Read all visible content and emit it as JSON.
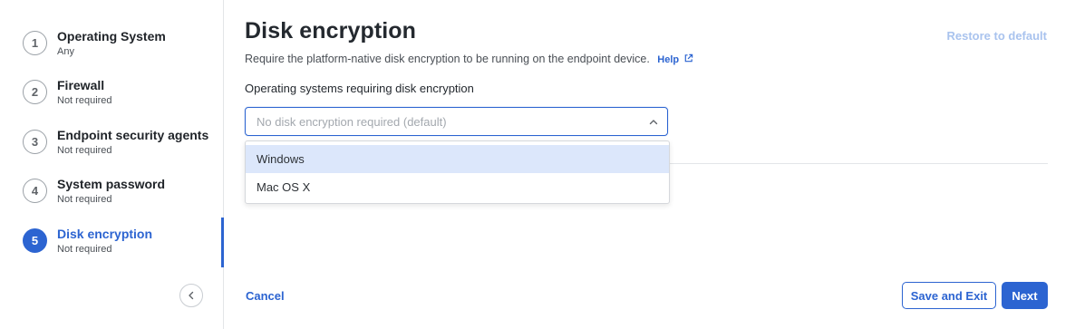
{
  "sidebar": {
    "steps": [
      {
        "number": "1",
        "title": "Operating System",
        "subtitle": "Any"
      },
      {
        "number": "2",
        "title": "Firewall",
        "subtitle": "Not required"
      },
      {
        "number": "3",
        "title": "Endpoint security agents",
        "subtitle": "Not required"
      },
      {
        "number": "4",
        "title": "System password",
        "subtitle": "Not required"
      },
      {
        "number": "5",
        "title": "Disk encryption",
        "subtitle": "Not required"
      }
    ],
    "active_step": "5",
    "collapse_icon": "chevron-left-icon"
  },
  "main": {
    "title": "Disk encryption",
    "restore_label": "Restore to default",
    "description": "Require the platform-native disk encryption to be running on the endpoint device.",
    "help_label": "Help",
    "help_icon": "external-link-icon",
    "field_label": "Operating systems requiring disk encryption",
    "select": {
      "placeholder": "No disk encryption required (default)",
      "icon": "chevron-up-icon",
      "options": [
        "Windows",
        "Mac OS X"
      ],
      "highlighted_option": "Windows"
    }
  },
  "footer": {
    "cancel_label": "Cancel",
    "save_exit_label": "Save and Exit",
    "next_label": "Next"
  },
  "colors": {
    "accent": "#2c64d1",
    "restore_disabled": "#a9c3ee",
    "option_highlight": "#dce7fb"
  }
}
